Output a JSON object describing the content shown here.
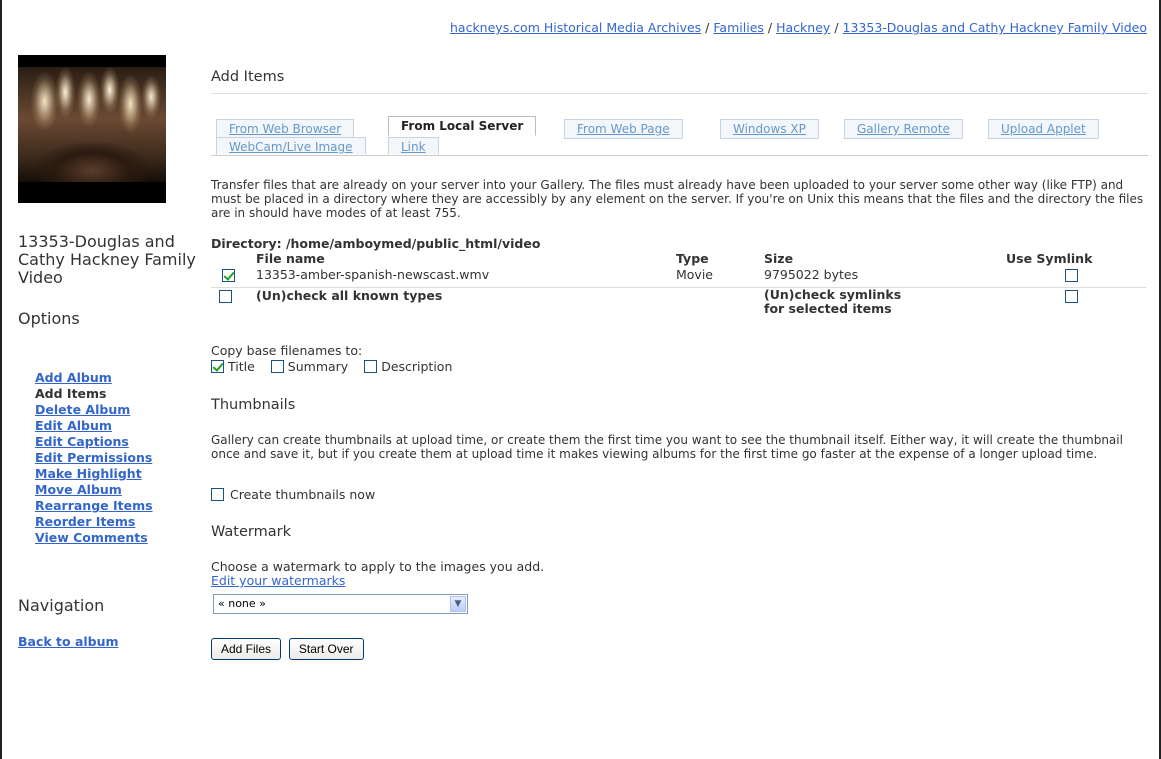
{
  "breadcrumb": [
    {
      "label": "hackneys.com Historical Media Archives"
    },
    {
      "label": "Families"
    },
    {
      "label": "Hackney"
    },
    {
      "label": "13353-Douglas and Cathy Hackney Family Video"
    }
  ],
  "sidebar": {
    "album_title": "13353-Douglas and Cathy Hackney Family Video",
    "options_heading": "Options",
    "options": [
      {
        "label": "Add Album"
      },
      {
        "label": "Add Items"
      },
      {
        "label": "Delete Album"
      },
      {
        "label": "Edit Album"
      },
      {
        "label": "Edit Captions"
      },
      {
        "label": "Edit Permissions"
      },
      {
        "label": "Make Highlight"
      },
      {
        "label": "Move Album"
      },
      {
        "label": "Rearrange Items"
      },
      {
        "label": "Reorder Items"
      },
      {
        "label": "View Comments"
      }
    ],
    "navigation_heading": "Navigation",
    "back_link": "Back to album"
  },
  "main": {
    "heading": "Add Items",
    "tabs": [
      {
        "label": "From Web Browser"
      },
      {
        "label": "From Local Server"
      },
      {
        "label": "From Web Page"
      },
      {
        "label": "Windows XP"
      },
      {
        "label": "Gallery Remote"
      },
      {
        "label": "Upload Applet"
      },
      {
        "label": "WebCam/Live Image"
      },
      {
        "label": "Link"
      }
    ],
    "description": "Transfer files that are already on your server into your Gallery. The files must already have been uploaded to your server some other way (like FTP) and must be placed in a directory where they are accessibly by any element on the server. If you're on Unix this means that the files and the directory the files are in should have modes of at least 755.",
    "directory": "Directory: /home/amboymed/public_html/video",
    "table": {
      "headers": {
        "name": "File name",
        "type": "Type",
        "size": "Size",
        "symlink": "Use Symlink"
      },
      "rows": [
        {
          "name": "13353-amber-spanish-newscast.wmv",
          "type": "Movie",
          "size": "9795022 bytes",
          "checked": true,
          "symlink": false
        }
      ],
      "check_all_label": "(Un)check all known types",
      "check_symlinks_label_1": "(Un)check symlinks",
      "check_symlinks_label_2": "for selected items"
    },
    "copy_base": {
      "label": "Copy base filenames to:",
      "options": [
        {
          "label": "Title",
          "checked": true
        },
        {
          "label": "Summary",
          "checked": false
        },
        {
          "label": "Description",
          "checked": false
        }
      ]
    },
    "thumbnails": {
      "heading": "Thumbnails",
      "description": "Gallery can create thumbnails at upload time, or create them the first time you want to see the thumbnail itself. Either way, it will create the thumbnail once and save it, but if you create them at upload time it makes viewing albums for the first time go faster at the expense of a longer upload time.",
      "create_now_label": "Create thumbnails now"
    },
    "watermark": {
      "heading": "Watermark",
      "description": "Choose a watermark to apply to the images you add.",
      "edit_link": "Edit your watermarks",
      "selected": "« none »"
    },
    "buttons": {
      "add": "Add Files",
      "start_over": "Start Over"
    }
  }
}
